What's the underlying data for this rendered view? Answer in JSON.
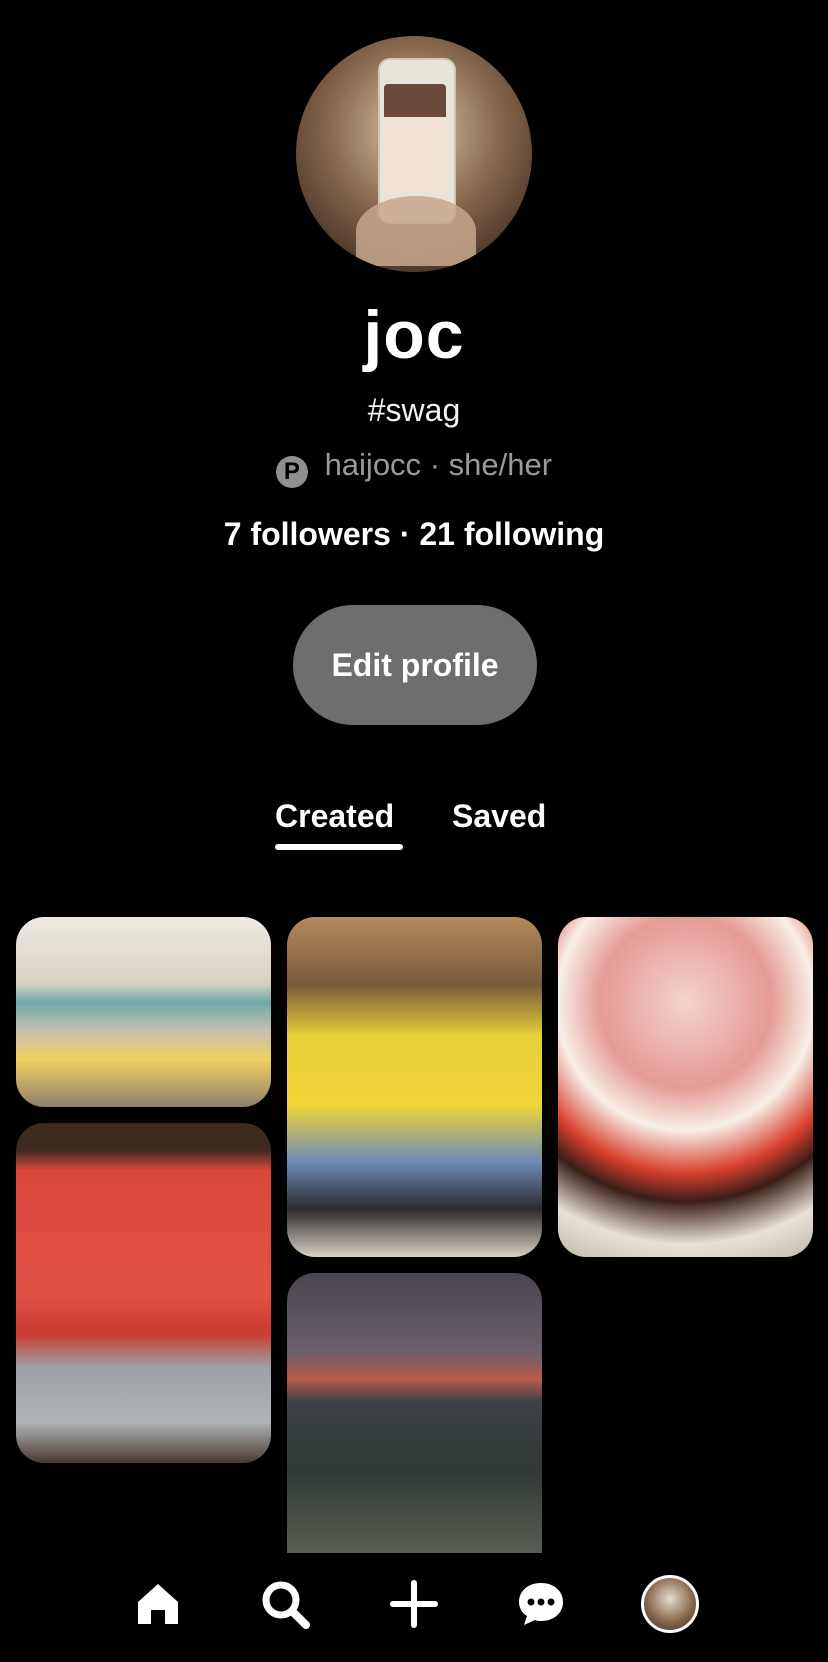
{
  "profile": {
    "name": "joc",
    "about": "#swag",
    "handle": "haijocc",
    "pronouns": "she/her",
    "separator": "·",
    "followers": "7 followers",
    "following": "21 following",
    "edit_label": "Edit profile"
  },
  "tabs": [
    {
      "label": "Created",
      "active": true
    },
    {
      "label": "Saved",
      "active": false
    }
  ],
  "pins": [
    {
      "name": "cafe-interior-pin"
    },
    {
      "name": "monchhichi-dolls-pin"
    },
    {
      "name": "minion-statue-pin"
    },
    {
      "name": "ocean-sunset-pin"
    },
    {
      "name": "frozen-yogurt-pin"
    }
  ],
  "nav": {
    "items": [
      "home-icon",
      "search-icon",
      "plus-icon",
      "chat-icon",
      "profile-avatar"
    ]
  },
  "colors": {
    "background": "#000000",
    "button": "#6e6e6e",
    "muted_text": "#9a9a9a"
  }
}
